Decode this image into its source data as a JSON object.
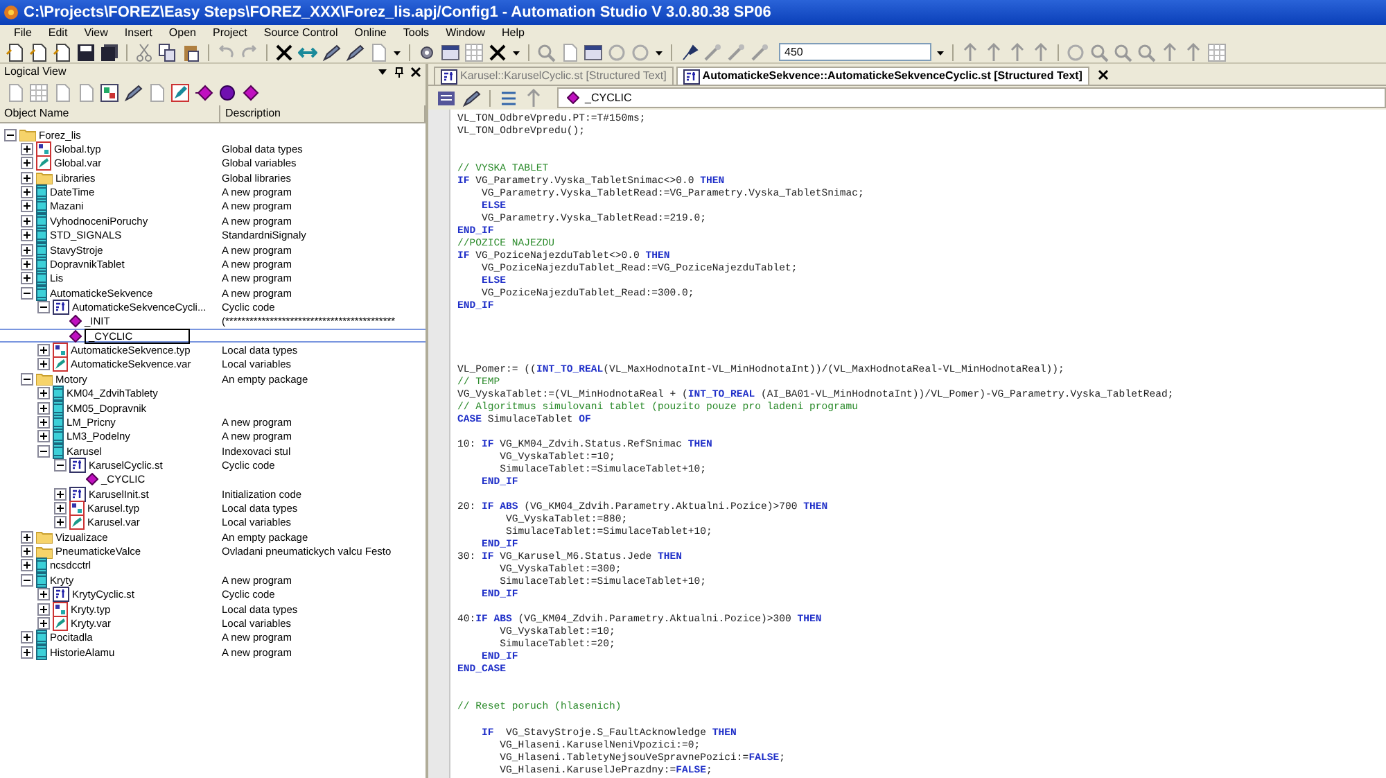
{
  "window": {
    "title": "C:\\Projects\\FOREZ\\Easy Steps\\FOREZ_XXX\\Forez_lis.apj/Config1 - Automation Studio V 3.0.80.38 SP06"
  },
  "menu": [
    "File",
    "Edit",
    "View",
    "Insert",
    "Open",
    "Project",
    "Source Control",
    "Online",
    "Tools",
    "Window",
    "Help"
  ],
  "toolbar": {
    "zoom_field": "450"
  },
  "logical_view": {
    "title": "Logical View",
    "columns": [
      "Object Name",
      "Description"
    ],
    "tree": [
      {
        "name": "Forez_lis",
        "kind": "folder",
        "expanded": true,
        "selected": false,
        "children": [
          {
            "name": "Global.typ",
            "desc": "Global data types",
            "kind": "typ",
            "expanded": false,
            "selected": false
          },
          {
            "name": "Global.var",
            "desc": "Global variables",
            "kind": "var",
            "expanded": false,
            "selected": false
          },
          {
            "name": "Libraries",
            "desc": "Global libraries",
            "kind": "folder",
            "expanded": false,
            "selected": false
          },
          {
            "name": "DateTime",
            "desc": "A new program",
            "kind": "program",
            "expanded": false,
            "selected": false
          },
          {
            "name": "Mazani",
            "desc": "A new program",
            "kind": "program",
            "expanded": false,
            "selected": false
          },
          {
            "name": "VyhodnoceniPoruchy",
            "desc": "A new program",
            "kind": "program",
            "expanded": false,
            "selected": false
          },
          {
            "name": "STD_SIGNALS",
            "desc": "StandardniSignaly",
            "kind": "program",
            "expanded": false,
            "selected": false
          },
          {
            "name": "StavyStroje",
            "desc": "A new program",
            "kind": "program",
            "expanded": false,
            "selected": false
          },
          {
            "name": "DopravnikTablet",
            "desc": "A new program",
            "kind": "program",
            "expanded": false,
            "selected": false
          },
          {
            "name": "Lis",
            "desc": "A new program",
            "kind": "program",
            "expanded": false,
            "selected": false
          },
          {
            "name": "AutomatickeSekvence",
            "desc": "A new program",
            "kind": "program",
            "expanded": true,
            "selected": false,
            "children": [
              {
                "name": "AutomatickeSekvenceCycli...",
                "desc": "Cyclic code",
                "kind": "st",
                "expanded": true,
                "selected": false,
                "children": [
                  {
                    "name": "_INIT",
                    "desc": "(******************************************",
                    "kind": "action",
                    "selected": false
                  },
                  {
                    "name": "_CYCLIC",
                    "kind": "action",
                    "selected": true
                  }
                ]
              },
              {
                "name": "AutomatickeSekvence.typ",
                "desc": "Local data types",
                "kind": "typ",
                "expanded": false,
                "selected": false
              },
              {
                "name": "AutomatickeSekvence.var",
                "desc": "Local variables",
                "kind": "var",
                "expanded": false,
                "selected": false
              }
            ]
          },
          {
            "name": "Motory",
            "desc": "An empty package",
            "kind": "folder",
            "expanded": true,
            "selected": false,
            "children": [
              {
                "name": "KM04_ZdvihTablety",
                "kind": "program",
                "expanded": false,
                "selected": false
              },
              {
                "name": "KM05_Dopravnik",
                "kind": "program",
                "expanded": false,
                "selected": false
              },
              {
                "name": "LM_Pricny",
                "desc": "A new program",
                "kind": "program",
                "expanded": false,
                "selected": false
              },
              {
                "name": "LM3_Podelny",
                "desc": "A new program",
                "kind": "program",
                "expanded": false,
                "selected": false
              },
              {
                "name": "Karusel",
                "desc": "Indexovaci stul",
                "kind": "program",
                "expanded": true,
                "selected": false,
                "children": [
                  {
                    "name": "KaruselCyclic.st",
                    "desc": "Cyclic code",
                    "kind": "st",
                    "expanded": true,
                    "selected": false,
                    "children": [
                      {
                        "name": "_CYCLIC",
                        "kind": "action",
                        "selected": false
                      }
                    ]
                  },
                  {
                    "name": "KaruselInit.st",
                    "desc": "Initialization code",
                    "kind": "st",
                    "expanded": false,
                    "selected": false
                  },
                  {
                    "name": "Karusel.typ",
                    "desc": "Local data types",
                    "kind": "typ",
                    "expanded": false,
                    "selected": false
                  },
                  {
                    "name": "Karusel.var",
                    "desc": "Local variables",
                    "kind": "var",
                    "expanded": false,
                    "selected": false
                  }
                ]
              }
            ]
          },
          {
            "name": "Vizualizace",
            "desc": "An empty package",
            "kind": "folder",
            "expanded": false,
            "selected": false
          },
          {
            "name": "PneumatickeValce",
            "desc": "Ovladani pneumatickych valcu Festo",
            "kind": "folder",
            "expanded": false,
            "selected": false
          },
          {
            "name": "ncsdcctrl",
            "kind": "program",
            "expanded": false,
            "selected": false
          },
          {
            "name": "Kryty",
            "desc": "A new program",
            "kind": "program",
            "expanded": true,
            "selected": false,
            "children": [
              {
                "name": "KrytyCyclic.st",
                "desc": "Cyclic code",
                "kind": "st",
                "expanded": false,
                "selected": false
              },
              {
                "name": "Kryty.typ",
                "desc": "Local data types",
                "kind": "typ",
                "expanded": false,
                "selected": false
              },
              {
                "name": "Kryty.var",
                "desc": "Local variables",
                "kind": "var",
                "expanded": false,
                "selected": false
              }
            ]
          },
          {
            "name": "Pocitadla",
            "desc": "A new program",
            "kind": "program",
            "expanded": false,
            "selected": false
          },
          {
            "name": "HistorieAlamu",
            "desc": "A new program",
            "kind": "program",
            "expanded": false,
            "selected": false
          }
        ]
      }
    ]
  },
  "editor": {
    "tabs": [
      {
        "label": "Karusel::KaruselCyclic.st [Structured Text]",
        "selected": false
      },
      {
        "label": "AutomatickeSekvence::AutomatickeSekvenceCyclic.st [Structured Text]",
        "selected": true
      }
    ],
    "action_dropdown": "_CYCLIC",
    "lines": [
      {
        "kind": "code",
        "parts": [
          {
            "kind": "plain",
            "text": "VL_TON_OdbreVpredu.PT:=T#150ms;"
          }
        ]
      },
      {
        "kind": "code",
        "parts": [
          {
            "kind": "plain",
            "text": "VL_TON_OdbreVpredu();"
          }
        ]
      },
      {
        "kind": "blank"
      },
      {
        "kind": "blank"
      },
      {
        "kind": "code",
        "parts": [
          {
            "kind": "comment",
            "text": "// VYSKA TABLET"
          }
        ]
      },
      {
        "kind": "code",
        "parts": [
          {
            "kind": "keyword",
            "text": "IF"
          },
          {
            "kind": "plain",
            "text": " VG_Parametry.Vyska_TabletSnimac<>0.0 "
          },
          {
            "kind": "keyword",
            "text": "THEN"
          }
        ]
      },
      {
        "kind": "code",
        "parts": [
          {
            "kind": "plain",
            "text": "    VG_Parametry.Vyska_TabletRead:=VG_Parametry.Vyska_TabletSnimac;"
          }
        ]
      },
      {
        "kind": "code",
        "parts": [
          {
            "kind": "keyword",
            "text": "    ELSE"
          }
        ]
      },
      {
        "kind": "code",
        "parts": [
          {
            "kind": "plain",
            "text": "    VG_Parametry.Vyska_TabletRead:=219.0;"
          }
        ]
      },
      {
        "kind": "code",
        "parts": [
          {
            "kind": "keyword",
            "text": "END_IF"
          }
        ]
      },
      {
        "kind": "code",
        "parts": [
          {
            "kind": "comment",
            "text": "//POZICE NAJEZDU"
          }
        ]
      },
      {
        "kind": "code",
        "parts": [
          {
            "kind": "keyword",
            "text": "IF"
          },
          {
            "kind": "plain",
            "text": " VG_PoziceNajezduTablet<>0.0 "
          },
          {
            "kind": "keyword",
            "text": "THEN"
          }
        ]
      },
      {
        "kind": "code",
        "parts": [
          {
            "kind": "plain",
            "text": "    VG_PoziceNajezduTablet_Read:=VG_PoziceNajezduTablet;"
          }
        ]
      },
      {
        "kind": "code",
        "parts": [
          {
            "kind": "keyword",
            "text": "    ELSE"
          }
        ]
      },
      {
        "kind": "code",
        "parts": [
          {
            "kind": "plain",
            "text": "    VG_PoziceNajezduTablet_Read:=300.0;"
          }
        ]
      },
      {
        "kind": "code",
        "parts": [
          {
            "kind": "keyword",
            "text": "END_IF"
          }
        ]
      },
      {
        "kind": "blank"
      },
      {
        "kind": "blank"
      },
      {
        "kind": "blank"
      },
      {
        "kind": "blank"
      },
      {
        "kind": "code",
        "parts": [
          {
            "kind": "plain",
            "text": "VL_Pomer:= (("
          },
          {
            "kind": "keyword",
            "text": "INT_TO_REAL"
          },
          {
            "kind": "plain",
            "text": "(VL_MaxHodnotaInt-VL_MinHodnotaInt))/(VL_MaxHodnotaReal-VL_MinHodnotaReal));"
          }
        ]
      },
      {
        "kind": "code",
        "parts": [
          {
            "kind": "comment",
            "text": "// TEMP"
          }
        ]
      },
      {
        "kind": "code",
        "parts": [
          {
            "kind": "plain",
            "text": "VG_VyskaTablet:=(VL_MinHodnotaReal + ("
          },
          {
            "kind": "keyword",
            "text": "INT_TO_REAL"
          },
          {
            "kind": "plain",
            "text": " (AI_BA01-VL_MinHodnotaInt))/VL_Pomer)-VG_Parametry.Vyska_TabletRead;"
          }
        ]
      },
      {
        "kind": "code",
        "parts": [
          {
            "kind": "comment",
            "text": "// Algoritmus simulovani tablet (pouzito pouze pro ladeni programu"
          }
        ]
      },
      {
        "kind": "code",
        "parts": [
          {
            "kind": "keyword",
            "text": "CASE"
          },
          {
            "kind": "plain",
            "text": " SimulaceTablet "
          },
          {
            "kind": "keyword",
            "text": "OF"
          }
        ]
      },
      {
        "kind": "blank"
      },
      {
        "kind": "code",
        "parts": [
          {
            "kind": "plain",
            "text": "10: "
          },
          {
            "kind": "keyword",
            "text": "IF"
          },
          {
            "kind": "plain",
            "text": " VG_KM04_Zdvih.Status.RefSnimac "
          },
          {
            "kind": "keyword",
            "text": "THEN"
          }
        ]
      },
      {
        "kind": "code",
        "parts": [
          {
            "kind": "plain",
            "text": "       VG_VyskaTablet:=10;"
          }
        ]
      },
      {
        "kind": "code",
        "parts": [
          {
            "kind": "plain",
            "text": "       SimulaceTablet:=SimulaceTablet+10;"
          }
        ]
      },
      {
        "kind": "code",
        "parts": [
          {
            "kind": "keyword",
            "text": "    END_IF"
          }
        ]
      },
      {
        "kind": "blank"
      },
      {
        "kind": "code",
        "parts": [
          {
            "kind": "plain",
            "text": "20: "
          },
          {
            "kind": "keyword",
            "text": "IF ABS"
          },
          {
            "kind": "plain",
            "text": " (VG_KM04_Zdvih.Parametry.Aktualni.Pozice)>700 "
          },
          {
            "kind": "keyword",
            "text": "THEN"
          }
        ]
      },
      {
        "kind": "code",
        "parts": [
          {
            "kind": "plain",
            "text": "        VG_VyskaTablet:=880;"
          }
        ]
      },
      {
        "kind": "code",
        "parts": [
          {
            "kind": "plain",
            "text": "        SimulaceTablet:=SimulaceTablet+10;"
          }
        ]
      },
      {
        "kind": "code",
        "parts": [
          {
            "kind": "keyword",
            "text": "    END_IF"
          }
        ]
      },
      {
        "kind": "code",
        "parts": [
          {
            "kind": "plain",
            "text": "30: "
          },
          {
            "kind": "keyword",
            "text": "IF"
          },
          {
            "kind": "plain",
            "text": " VG_Karusel_M6.Status.Jede "
          },
          {
            "kind": "keyword",
            "text": "THEN"
          }
        ]
      },
      {
        "kind": "code",
        "parts": [
          {
            "kind": "plain",
            "text": "       VG_VyskaTablet:=300;"
          }
        ]
      },
      {
        "kind": "code",
        "parts": [
          {
            "kind": "plain",
            "text": "       SimulaceTablet:=SimulaceTablet+10;"
          }
        ]
      },
      {
        "kind": "code",
        "parts": [
          {
            "kind": "keyword",
            "text": "    END_IF"
          }
        ]
      },
      {
        "kind": "blank"
      },
      {
        "kind": "code",
        "parts": [
          {
            "kind": "plain",
            "text": "40:"
          },
          {
            "kind": "keyword",
            "text": "IF ABS"
          },
          {
            "kind": "plain",
            "text": " (VG_KM04_Zdvih.Parametry.Aktualni.Pozice)>300 "
          },
          {
            "kind": "keyword",
            "text": "THEN"
          }
        ]
      },
      {
        "kind": "code",
        "parts": [
          {
            "kind": "plain",
            "text": "       VG_VyskaTablet:=10;"
          }
        ]
      },
      {
        "kind": "code",
        "parts": [
          {
            "kind": "plain",
            "text": "       SimulaceTablet:=20;"
          }
        ]
      },
      {
        "kind": "code",
        "parts": [
          {
            "kind": "keyword",
            "text": "    END_IF"
          }
        ]
      },
      {
        "kind": "code",
        "parts": [
          {
            "kind": "keyword",
            "text": "END_CASE"
          }
        ]
      },
      {
        "kind": "blank"
      },
      {
        "kind": "blank"
      },
      {
        "kind": "code",
        "parts": [
          {
            "kind": "comment",
            "text": "// Reset poruch (hlasenich)"
          }
        ]
      },
      {
        "kind": "blank"
      },
      {
        "kind": "code",
        "parts": [
          {
            "kind": "keyword",
            "text": "    IF"
          },
          {
            "kind": "plain",
            "text": "  VG_StavyStroje.S_FaultAcknowledge "
          },
          {
            "kind": "keyword",
            "text": "THEN"
          }
        ]
      },
      {
        "kind": "code",
        "parts": [
          {
            "kind": "plain",
            "text": "       VG_Hlaseni.KaruselNeniVpozici:=0;"
          }
        ]
      },
      {
        "kind": "code",
        "parts": [
          {
            "kind": "plain",
            "text": "       VG_Hlaseni.TabletyNejsouVeSpravnePozici:="
          },
          {
            "kind": "keyword",
            "text": "FALSE"
          },
          {
            "kind": "plain",
            "text": ";"
          }
        ]
      },
      {
        "kind": "code",
        "parts": [
          {
            "kind": "plain",
            "text": "       VG_Hlaseni.KaruselJePrazdny:="
          },
          {
            "kind": "keyword",
            "text": "FALSE"
          },
          {
            "kind": "plain",
            "text": ";"
          }
        ]
      }
    ]
  }
}
